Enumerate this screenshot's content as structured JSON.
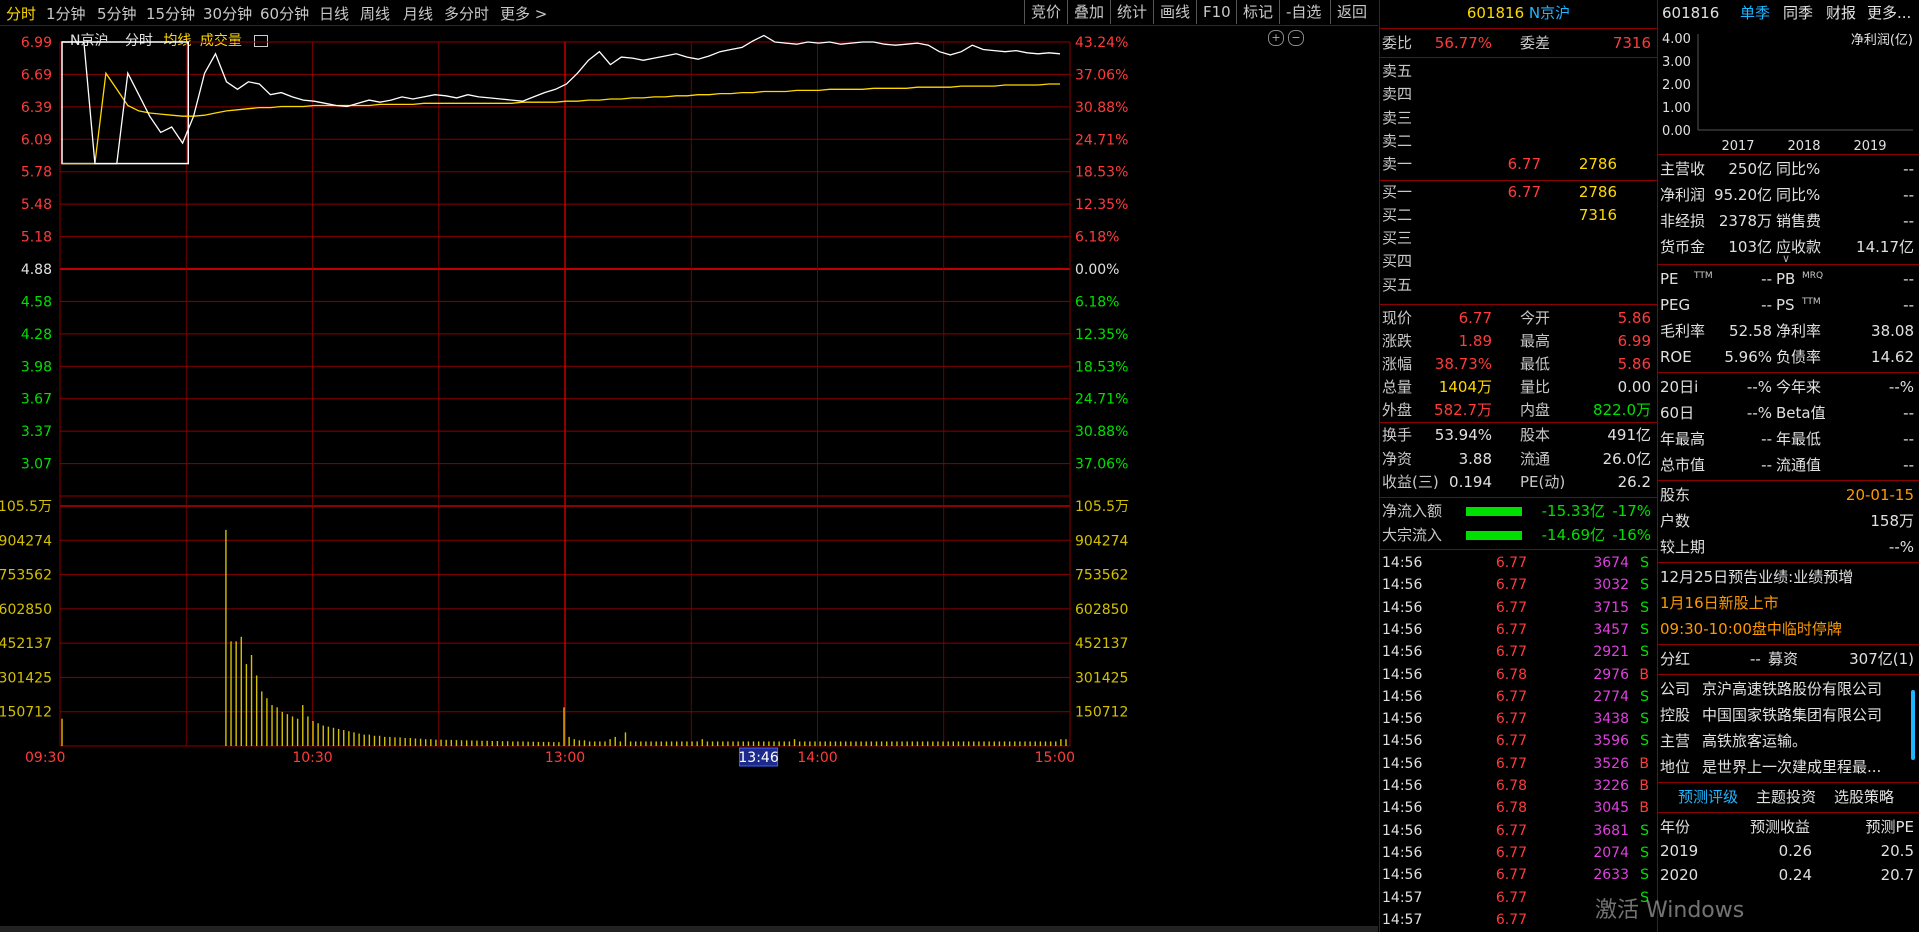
{
  "toolbar": {
    "periods": [
      "分时",
      "1分钟",
      "5分钟",
      "15分钟",
      "30分钟",
      "60分钟",
      "日线",
      "周线",
      "月线",
      "多分时",
      "更多 >"
    ],
    "buttons": [
      "竞价",
      "叠加",
      "统计",
      "画线",
      "F10",
      "标记",
      "-自选",
      "返回"
    ]
  },
  "chart_header": {
    "name": "N京沪",
    "mode": "分时",
    "avg": "均线",
    "vol": "成交量"
  },
  "chart_data": {
    "type": "line",
    "price_axis_left": [
      "6.99",
      "6.69",
      "6.39",
      "6.09",
      "5.78",
      "5.48",
      "5.18",
      "4.88",
      "4.58",
      "4.28",
      "3.98",
      "3.67",
      "3.37",
      "3.07"
    ],
    "pct_axis_right": [
      "43.24%",
      "37.06%",
      "30.88%",
      "24.71%",
      "18.53%",
      "12.35%",
      "6.18%",
      "0.00%",
      "6.18%",
      "12.35%",
      "18.53%",
      "24.71%",
      "30.88%",
      "37.06%"
    ],
    "volume_axis": [
      "105.5万",
      "904274",
      "753562",
      "602850",
      "452137",
      "301425",
      "150712"
    ],
    "time_axis": [
      "09:30",
      "10:30",
      "13:00",
      "13:46",
      "14:00",
      "15:00"
    ],
    "prev_close": 4.88,
    "price_range": [
      2.77,
      6.99
    ],
    "price_series": [
      6.99,
      6.99,
      6.99,
      5.86,
      5.86,
      5.86,
      6.7,
      6.5,
      6.3,
      6.15,
      6.2,
      6.05,
      6.3,
      6.7,
      6.88,
      6.62,
      6.55,
      6.62,
      6.6,
      6.5,
      6.52,
      6.48,
      6.45,
      6.44,
      6.42,
      6.4,
      6.39,
      6.42,
      6.45,
      6.43,
      6.45,
      6.48,
      6.46,
      6.48,
      6.5,
      6.49,
      6.47,
      6.5,
      6.48,
      6.47,
      6.46,
      6.45,
      6.44,
      6.48,
      6.52,
      6.55,
      6.6,
      6.7,
      6.82,
      6.9,
      6.78,
      6.85,
      6.84,
      6.82,
      6.84,
      6.86,
      6.88,
      6.85,
      6.83,
      6.86,
      6.9,
      6.92,
      6.94,
      7.0,
      7.05,
      6.99,
      6.98,
      6.97,
      6.99,
      6.98,
      6.99,
      6.97,
      6.98,
      6.99,
      6.99,
      6.97,
      6.96,
      6.97,
      6.98,
      6.96,
      6.9,
      6.87,
      6.9,
      6.96,
      6.92,
      6.91,
      6.9,
      6.91,
      6.89,
      6.88,
      6.89,
      6.88
    ],
    "avg_series": [
      5.86,
      5.86,
      5.86,
      5.86,
      6.7,
      6.55,
      6.4,
      6.35,
      6.33,
      6.32,
      6.31,
      6.3,
      6.3,
      6.31,
      6.33,
      6.35,
      6.36,
      6.37,
      6.38,
      6.38,
      6.39,
      6.39,
      6.39,
      6.4,
      6.4,
      6.4,
      6.4,
      6.4,
      6.4,
      6.41,
      6.41,
      6.41,
      6.41,
      6.42,
      6.42,
      6.42,
      6.42,
      6.42,
      6.42,
      6.42,
      6.42,
      6.42,
      6.43,
      6.43,
      6.43,
      6.43,
      6.44,
      6.44,
      6.45,
      6.45,
      6.46,
      6.46,
      6.47,
      6.47,
      6.48,
      6.48,
      6.49,
      6.49,
      6.5,
      6.5,
      6.51,
      6.51,
      6.52,
      6.52,
      6.53,
      6.53,
      6.53,
      6.54,
      6.54,
      6.54,
      6.55,
      6.55,
      6.55,
      6.55,
      6.56,
      6.56,
      6.56,
      6.56,
      6.57,
      6.57,
      6.57,
      6.57,
      6.58,
      6.58,
      6.58,
      6.58,
      6.59,
      6.59,
      6.59,
      6.59,
      6.6,
      6.6
    ],
    "volume_values": [
      120000,
      0,
      0,
      0,
      0,
      0,
      0,
      0,
      0,
      0,
      0,
      0,
      0,
      0,
      0,
      0,
      0,
      0,
      0,
      0,
      0,
      0,
      0,
      0,
      0,
      0,
      0,
      0,
      0,
      0,
      0,
      0,
      950000,
      460000,
      460000,
      480000,
      360000,
      400000,
      310000,
      240000,
      210000,
      180000,
      170000,
      150000,
      140000,
      130000,
      120000,
      180000,
      130000,
      110000,
      100000,
      90000,
      85000,
      80000,
      75000,
      70000,
      65000,
      60000,
      55000,
      50000,
      50000,
      45000,
      45000,
      40000,
      40000,
      38000,
      38000,
      35000,
      35000,
      33000,
      32000,
      30000,
      30000,
      28000,
      28000,
      27000,
      27000,
      26000,
      25000,
      25000,
      24000,
      24000,
      23000,
      23000,
      22000,
      22000,
      21000,
      21000,
      20000,
      20000,
      20000,
      19000,
      19000,
      18000,
      18000,
      18000,
      17000,
      17000,
      170000,
      40000,
      30000,
      25000,
      25000,
      20000,
      20000,
      20000,
      20000,
      30000,
      40000,
      20000,
      60000,
      20000,
      20000,
      20000,
      20000,
      20000,
      20000,
      20000,
      20000,
      20000,
      20000,
      20000,
      20000,
      20000,
      20000,
      30000,
      20000,
      20000,
      20000,
      20000,
      20000,
      20000,
      20000,
      20000,
      20000,
      20000,
      20000,
      20000,
      20000,
      20000,
      20000,
      20000,
      20000,
      30000,
      20000,
      20000,
      20000,
      20000,
      20000,
      20000,
      20000,
      20000,
      20000,
      20000,
      20000,
      20000,
      20000,
      20000,
      20000,
      20000,
      20000,
      20000,
      20000,
      20000,
      20000,
      20000,
      20000,
      20000,
      20000,
      20000,
      20000,
      20000,
      20000,
      20000,
      20000,
      20000,
      20000,
      20000,
      20000,
      20000,
      20000,
      20000,
      20000,
      20000,
      20000,
      20000,
      20000,
      20000,
      20000,
      20000,
      20000,
      20000,
      20000,
      20000,
      20000,
      30000,
      30000
    ]
  },
  "quote": {
    "code": "601816",
    "name": "N京沪",
    "weibi_label": "委比",
    "weibi": "56.77%",
    "weicha_label": "委差",
    "weicha": "7316",
    "sell": [
      [
        "卖五",
        "",
        ""
      ],
      [
        "卖四",
        "",
        ""
      ],
      [
        "卖三",
        "",
        ""
      ],
      [
        "卖二",
        "",
        ""
      ],
      [
        "卖一",
        "6.77",
        "2786"
      ]
    ],
    "buy": [
      [
        "买一",
        "6.77",
        "2786"
      ],
      [
        "买二",
        "",
        "7316"
      ],
      [
        "买三",
        "",
        ""
      ],
      [
        "买四",
        "",
        ""
      ],
      [
        "买五",
        "",
        ""
      ]
    ],
    "stats": [
      [
        "现价",
        "6.77",
        "今开",
        "5.86"
      ],
      [
        "涨跌",
        "1.89",
        "最高",
        "6.99"
      ],
      [
        "涨幅",
        "38.73%",
        "最低",
        "5.86"
      ],
      [
        "总量",
        "1404万",
        "量比",
        "0.00"
      ],
      [
        "外盘",
        "582.7万",
        "内盘",
        "822.0万"
      ]
    ],
    "stats2": [
      [
        "换手",
        "53.94%",
        "股本",
        "491亿"
      ],
      [
        "净资",
        "3.88",
        "流通",
        "26.0亿"
      ],
      [
        "收益(三)",
        "0.194",
        "PE(动)",
        "26.2"
      ]
    ],
    "flow": [
      [
        "净流入额",
        "-15.33亿",
        "-17%"
      ],
      [
        "大宗流入",
        "-14.69亿",
        "-16%"
      ]
    ],
    "ticks": [
      [
        "14:56",
        "6.77",
        "3674",
        "S"
      ],
      [
        "14:56",
        "6.77",
        "3032",
        "S"
      ],
      [
        "14:56",
        "6.77",
        "3715",
        "S"
      ],
      [
        "14:56",
        "6.77",
        "3457",
        "S"
      ],
      [
        "14:56",
        "6.77",
        "2921",
        "S"
      ],
      [
        "14:56",
        "6.78",
        "2976",
        "B"
      ],
      [
        "14:56",
        "6.77",
        "2774",
        "S"
      ],
      [
        "14:56",
        "6.77",
        "3438",
        "S"
      ],
      [
        "14:56",
        "6.77",
        "3596",
        "S"
      ],
      [
        "14:56",
        "6.77",
        "3526",
        "B"
      ],
      [
        "14:56",
        "6.78",
        "3226",
        "B"
      ],
      [
        "14:56",
        "6.78",
        "3045",
        "B"
      ],
      [
        "14:56",
        "6.77",
        "3681",
        "S"
      ],
      [
        "14:56",
        "6.77",
        "2074",
        "S"
      ],
      [
        "14:56",
        "6.77",
        "2633",
        "S"
      ],
      [
        "14:57",
        "6.77",
        "",
        "S"
      ],
      [
        "14:57",
        "6.77",
        "",
        ""
      ]
    ]
  },
  "fin": {
    "code": "601816",
    "tabs": [
      "单季",
      "同季",
      "财报",
      "更多..."
    ],
    "chart_axis": [
      "4.00",
      "3.00",
      "2.00",
      "1.00",
      "0.00"
    ],
    "chart_years": [
      "2017",
      "2018",
      "2019"
    ],
    "chart_label": "净利润(亿)",
    "rows1": [
      [
        "主营收",
        "250亿",
        "同比%",
        "--"
      ],
      [
        "净利润",
        "95.20亿",
        "同比%",
        "--"
      ],
      [
        "非经损",
        "2378万",
        "销售费",
        "--"
      ],
      [
        "货币金",
        "103亿",
        "应收款",
        "14.17亿"
      ]
    ],
    "rows2": [
      [
        "PE",
        "TTM",
        "--",
        "PB",
        "MRQ",
        "--"
      ],
      [
        "PEG",
        "",
        "--",
        "PS",
        "TTM",
        "--"
      ]
    ],
    "rows3": [
      [
        "毛利率",
        "52.58",
        "净利率",
        "38.08"
      ],
      [
        "ROE",
        "5.96%",
        "负债率",
        "14.62"
      ]
    ],
    "rows4": [
      [
        "20日i",
        "--%",
        "今年来",
        "--%"
      ],
      [
        "60日",
        "--%",
        "Beta值",
        "--"
      ],
      [
        "年最高",
        "--",
        "年最低",
        "--"
      ],
      [
        "总市值",
        "--",
        "流通值",
        "--"
      ]
    ],
    "holders": [
      [
        "股东",
        "20-01-15"
      ],
      [
        "户数",
        "158万"
      ],
      [
        "较上期",
        "--%"
      ]
    ],
    "news": [
      "12月25日预告业绩:业绩预增",
      "1月16日新股上市",
      "09:30-10:00盘中临时停牌"
    ],
    "div": [
      "分红",
      "--",
      "募资",
      "307亿(1)"
    ],
    "company": [
      [
        "公司",
        "京沪高速铁路股份有限公司"
      ],
      [
        "控股",
        "中国国家铁路集团有限公司"
      ],
      [
        "主营",
        "高铁旅客运输。"
      ],
      [
        "地位",
        "是世界上一次建成里程最..."
      ]
    ],
    "subtabs": [
      "预测评级",
      "主题投资",
      "选股策略"
    ],
    "forecast_head": [
      "年份",
      "预测收益",
      "预测PE"
    ],
    "forecast": [
      [
        "2019",
        "0.26",
        "20.5"
      ],
      [
        "2020",
        "0.24",
        "20.7"
      ]
    ],
    "watermark": "激活 Windows"
  },
  "colors": {
    "grid": "#8b0000",
    "price": "#ffffff",
    "avg": "#ffd800",
    "up": "#ff3b3b",
    "down": "#00e000",
    "vol": "#d4c000"
  }
}
